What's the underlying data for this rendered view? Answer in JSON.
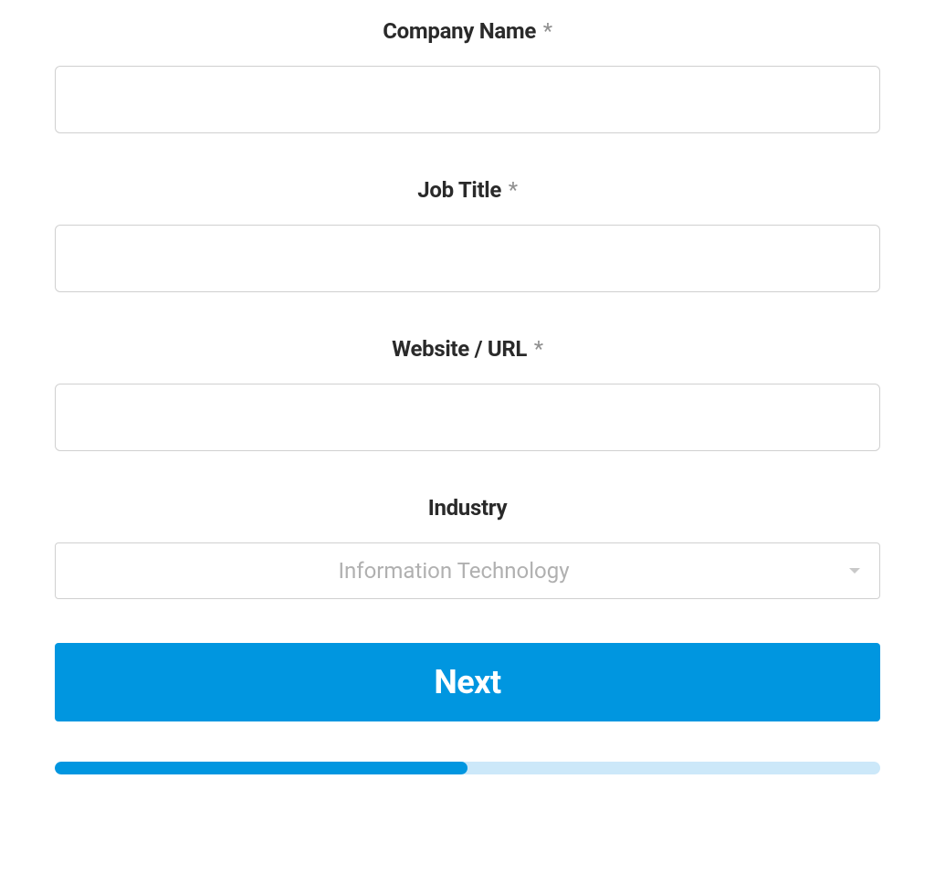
{
  "form": {
    "fields": {
      "company": {
        "label": "Company Name",
        "required": true,
        "value": ""
      },
      "job_title": {
        "label": "Job Title",
        "required": true,
        "value": ""
      },
      "website": {
        "label": "Website / URL",
        "required": true,
        "value": ""
      },
      "industry": {
        "label": "Industry",
        "required": false,
        "selected": "Information Technology"
      }
    },
    "required_marker": "*",
    "next_button": "Next",
    "progress_percent": 50
  },
  "colors": {
    "primary": "#0096e0",
    "progress_bg": "#cce8f9"
  }
}
